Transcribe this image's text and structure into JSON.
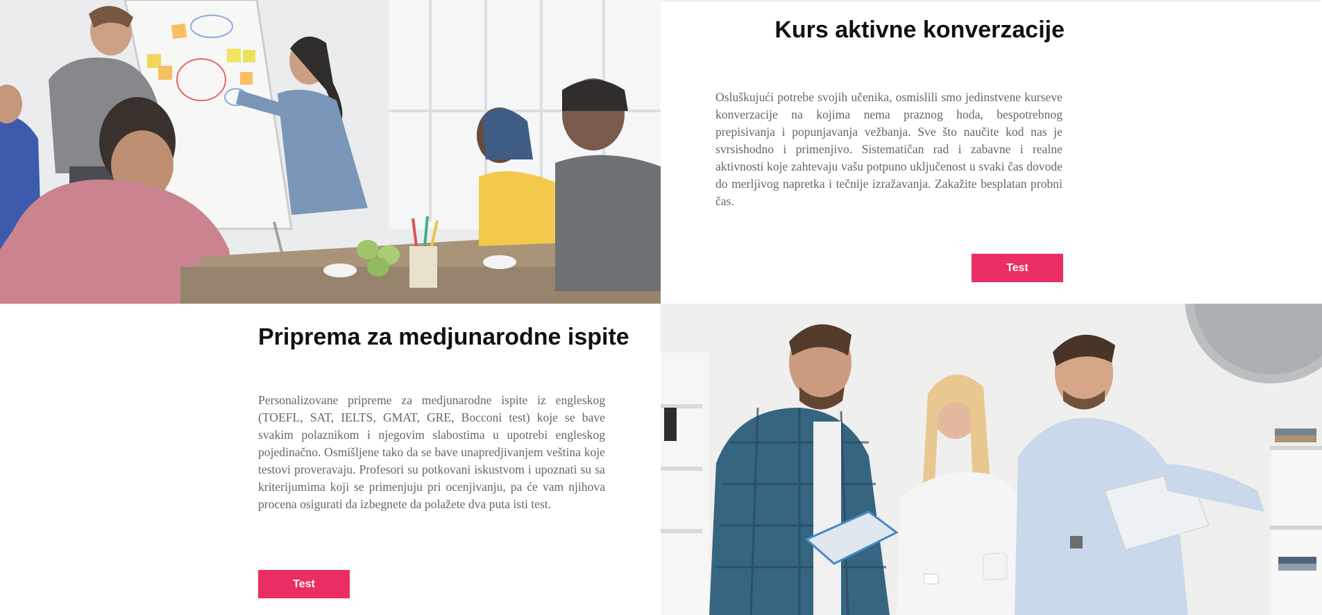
{
  "sections": [
    {
      "title": "Kurs aktivne konverzacije",
      "body": "Osluškujući potrebe svojih učenika, osmislili smo jedinstvene kurseve konverzacije na kojima nema praznog hoda, bespotrebnog prepisivanja i popunjavanja vežbanja. Sve što naučite kod nas je svrsishodno i primenjivo. Sistematičan rad i zabavne i realne aktivnosti koje zahtevaju vašu potpuno uključenost u svaki čas dovode do merljivog napretka i tečnije izražavanja. Zakažite besplatan probni čas.",
      "button_label": "Test",
      "image": "group-meeting-whiteboard-photo"
    },
    {
      "title": "Priprema za medjunarodne ispite",
      "body": "Personalizovane pripreme za medjunarodne ispite iz engleskog (TOEFL, SAT, IELTS, GMAT, GRE, Bocconi test) koje se bave svakim polaznikom i njegovim slabostima u upotrebi engleskog pojedinačno. Osmišljene tako da se bave unapredjivanjem veština koje testovi proveravaju. Profesori su potkovani iskustvom i upoznati su sa kriterijumima koji se primenjuju pri ocenjivanju, pa će vam njihova procena osigurati da izbegnete da polažete dva puta isti test.",
      "button_label": "Test",
      "image": "three-students-reading-photo"
    }
  ],
  "colors": {
    "accent": "#ea2e64",
    "title": "#111111",
    "body": "#666666"
  }
}
